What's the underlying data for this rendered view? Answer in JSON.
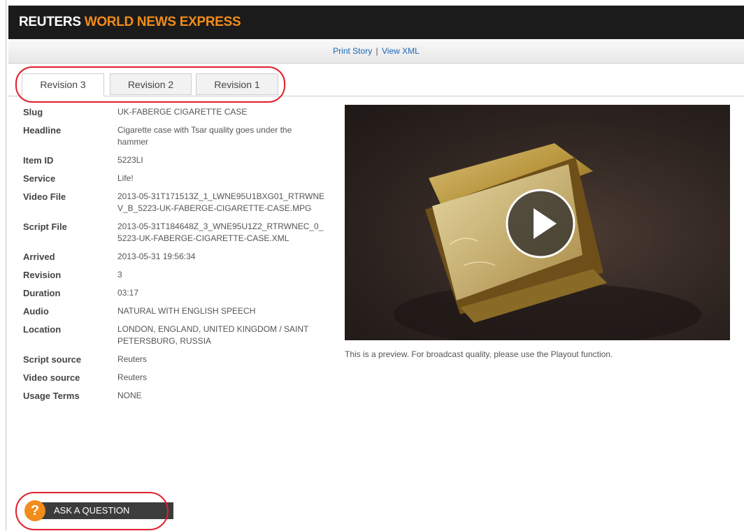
{
  "header": {
    "brand_part1": "REUTERS",
    "brand_part2": "WORLD NEWS EXPRESS",
    "brand_color": "#f28c1a"
  },
  "subbar": {
    "print_story": "Print Story",
    "separator": "|",
    "view_xml": "View XML"
  },
  "tabs": [
    {
      "label": "Revision 3",
      "active": true
    },
    {
      "label": "Revision 2",
      "active": false
    },
    {
      "label": "Revision 1",
      "active": false
    }
  ],
  "metadata": [
    {
      "key": "Slug",
      "value": "UK-FABERGE CIGARETTE CASE"
    },
    {
      "key": "Headline",
      "value": "Cigarette case with Tsar quality goes under the hammer"
    },
    {
      "key": "Item ID",
      "value": "5223LI"
    },
    {
      "key": "Service",
      "value": "Life!"
    },
    {
      "key": "Video File",
      "value": "2013-05-31T171513Z_1_LWNE95U1BXG01_RTRWNEV_B_5223-UK-FABERGE-CIGARETTE-CASE.MPG"
    },
    {
      "key": "Script File",
      "value": "2013-05-31T184648Z_3_WNE95U1Z2_RTRWNEC_0_5223-UK-FABERGE-CIGARETTE-CASE.XML"
    },
    {
      "key": "Arrived",
      "value": "2013-05-31 19:56:34"
    },
    {
      "key": "Revision",
      "value": "3"
    },
    {
      "key": "Duration",
      "value": "03:17"
    },
    {
      "key": "Audio",
      "value": "NATURAL WITH ENGLISH SPEECH"
    },
    {
      "key": "Location",
      "value": "LONDON, ENGLAND, UNITED KINGDOM / SAINT PETERSBURG, RUSSIA"
    },
    {
      "key": "Script source",
      "value": "Reuters"
    },
    {
      "key": "Video source",
      "value": "Reuters"
    },
    {
      "key": "Usage Terms",
      "value": "NONE"
    }
  ],
  "video": {
    "play_icon": "play-icon",
    "caption": "This is a preview. For broadcast quality, please use the Playout function."
  },
  "ask": {
    "icon_glyph": "?",
    "label": "ASK A QUESTION",
    "icon": "question-icon"
  },
  "colors": {
    "header_bg": "#1b1b1b",
    "accent": "#f28c1a",
    "link": "#1a66b8",
    "annotation_ring": "#e0202a"
  }
}
